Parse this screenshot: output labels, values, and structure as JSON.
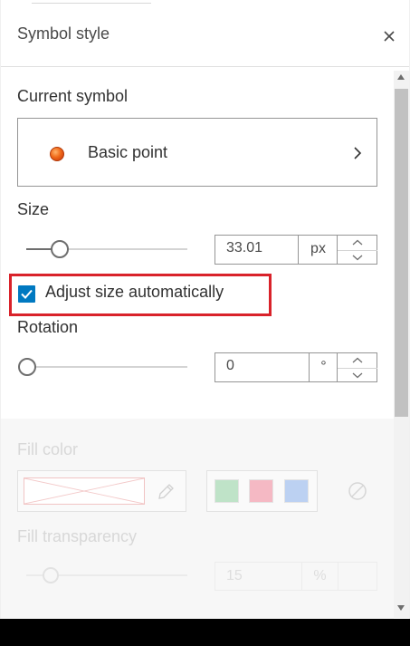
{
  "panel": {
    "title": "Symbol style"
  },
  "current_symbol": {
    "label": "Current symbol",
    "name": "Basic point",
    "color": "#f06a1a"
  },
  "size": {
    "label": "Size",
    "value": "33.01",
    "unit": "px",
    "slider_level": 0.2
  },
  "adjust_size": {
    "label": "Adjust size automatically",
    "checked": true
  },
  "rotation": {
    "label": "Rotation",
    "value": "0",
    "unit": "°",
    "slider_level": 0
  },
  "fill_color": {
    "label": "Fill color",
    "swatches": [
      "#bfe3c8",
      "#f5b9c4",
      "#bcd1f2"
    ]
  },
  "fill_transparency": {
    "label": "Fill transparency",
    "value": "15",
    "unit": "%"
  },
  "colors": {
    "accent": "#0079c1",
    "highlight": "#d9222a"
  }
}
